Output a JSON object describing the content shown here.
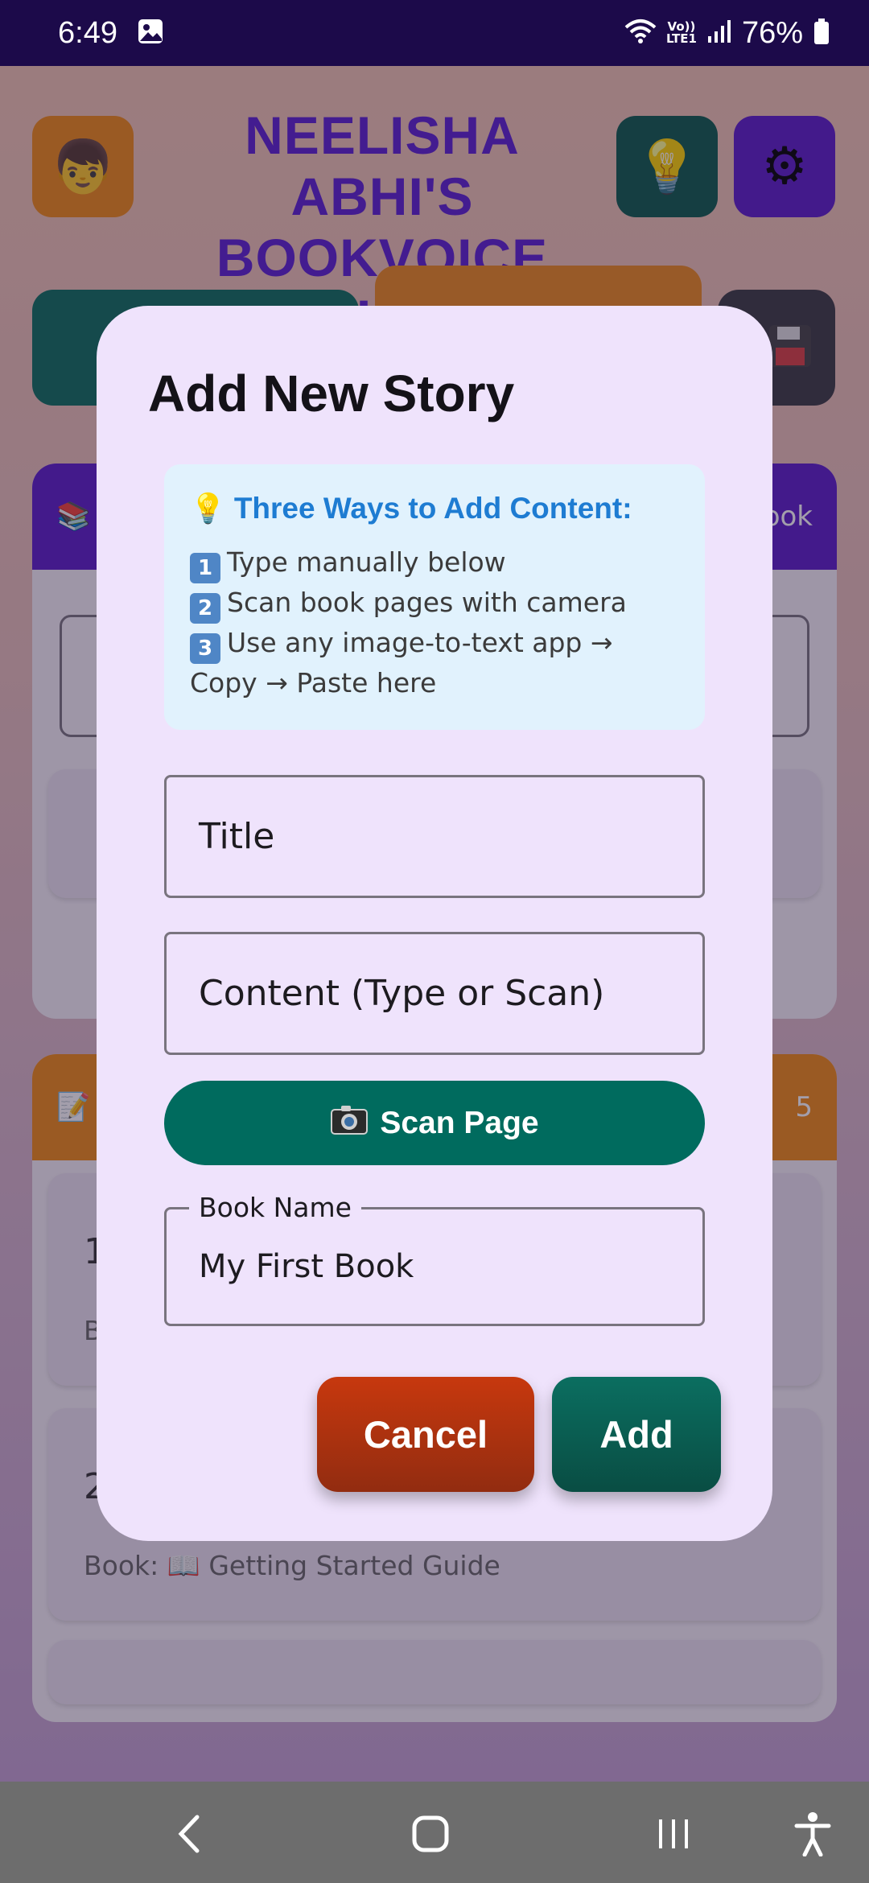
{
  "status_bar": {
    "time": "6:49",
    "battery": "76%",
    "volte_line1": "Vo))",
    "volte_line2": "LTE1"
  },
  "app": {
    "title": "NEELISHA ABHI'S BOOKVOICE KIDS",
    "library_card_label_suffix": "ook",
    "stories_card_count": "5",
    "story_item_1_number": "1",
    "story_item_1_book_prefix": "B",
    "story_item_2_number": "2",
    "story_item_2_book": "Book: 📖 Getting Started Guide"
  },
  "dialog": {
    "title": "Add New Story",
    "info_title": "Three Ways to Add Content:",
    "info_lines": [
      {
        "num": "1",
        "text": "Type manually below"
      },
      {
        "num": "2",
        "text": "Scan book pages with camera"
      },
      {
        "num": "3",
        "text": "Use any image-to-text app → Copy → Paste here"
      }
    ],
    "title_placeholder": "Title",
    "content_placeholder": "Content (Type or Scan)",
    "scan_label": "Scan Page",
    "book_name_label": "Book Name",
    "book_name_value": "My First Book",
    "cancel_label": "Cancel",
    "add_label": "Add"
  },
  "colors": {
    "accent_green": "#006b5e",
    "accent_purple": "#5b1fd0",
    "cancel_red": "#c7380e",
    "info_blue": "#1e7cd2",
    "dialog_bg": "#efe3fc"
  }
}
